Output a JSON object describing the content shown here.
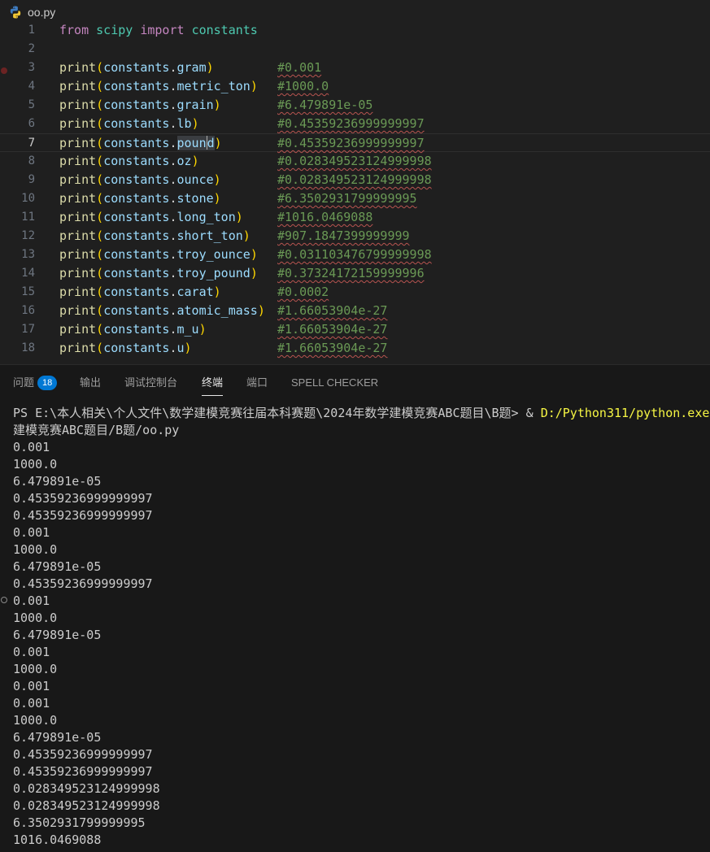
{
  "editor": {
    "filename": "oo.py",
    "lines": [
      {
        "num": "1",
        "kind": "import",
        "kw1": "from",
        "module": "scipy",
        "kw2": "import",
        "name": "constants"
      },
      {
        "num": "2",
        "kind": "blank"
      },
      {
        "num": "3",
        "kind": "print",
        "attr": "gram",
        "comment": "#0.001"
      },
      {
        "num": "4",
        "kind": "print",
        "attr": "metric_ton",
        "comment": "#1000.0"
      },
      {
        "num": "5",
        "kind": "print",
        "attr": "grain",
        "comment": "#6.479891e-05"
      },
      {
        "num": "6",
        "kind": "print",
        "attr": "lb",
        "comment": "#0.45359236999999997"
      },
      {
        "num": "7",
        "kind": "print",
        "attr": "pound",
        "comment": "#0.45359236999999997",
        "current": true
      },
      {
        "num": "8",
        "kind": "print",
        "attr": "oz",
        "comment": "#0.028349523124999998"
      },
      {
        "num": "9",
        "kind": "print",
        "attr": "ounce",
        "comment": "#0.028349523124999998"
      },
      {
        "num": "10",
        "kind": "print",
        "attr": "stone",
        "comment": "#6.3502931799999995"
      },
      {
        "num": "11",
        "kind": "print",
        "attr": "long_ton",
        "comment": "#1016.0469088"
      },
      {
        "num": "12",
        "kind": "print",
        "attr": "short_ton",
        "comment": "#907.1847399999999"
      },
      {
        "num": "13",
        "kind": "print",
        "attr": "troy_ounce",
        "comment": "#0.031103476799999998"
      },
      {
        "num": "14",
        "kind": "print",
        "attr": "troy_pound",
        "comment": "#0.37324172159999996"
      },
      {
        "num": "15",
        "kind": "print",
        "attr": "carat",
        "comment": "#0.0002"
      },
      {
        "num": "16",
        "kind": "print",
        "attr": "atomic_mass",
        "comment": "#1.66053904e-27"
      },
      {
        "num": "17",
        "kind": "print",
        "attr": "m_u",
        "comment": "#1.66053904e-27"
      },
      {
        "num": "18",
        "kind": "print",
        "attr": "u",
        "comment": "#1.66053904e-27"
      }
    ],
    "print_fn": "print",
    "object": "constants"
  },
  "panel": {
    "tabs": [
      {
        "label": "问题",
        "badge": "18"
      },
      {
        "label": "输出"
      },
      {
        "label": "调试控制台"
      },
      {
        "label": "终端",
        "active": true
      },
      {
        "label": "端口"
      },
      {
        "label": "SPELL CHECKER"
      }
    ]
  },
  "terminal": {
    "prompt": "PS E:\\本人相关\\个人文件\\数学建模竞赛往届本科赛题\\2024年数学建模竞赛ABC题目\\B题> & ",
    "command": "D:/Python311/python.exe",
    "wrap_line": "建模竞赛ABC题目/B题/oo.py",
    "output": [
      "0.001",
      "1000.0",
      "6.479891e-05",
      "0.45359236999999997",
      "0.45359236999999997",
      "0.001",
      "1000.0",
      "6.479891e-05",
      "0.45359236999999997",
      "0.001",
      "1000.0",
      "6.479891e-05",
      "0.001",
      "1000.0",
      "0.001",
      "0.001",
      "1000.0",
      "6.479891e-05",
      "0.45359236999999997",
      "0.45359236999999997",
      "0.028349523124999998",
      "0.028349523124999998",
      "6.3502931799999995",
      "1016.0469088"
    ]
  }
}
